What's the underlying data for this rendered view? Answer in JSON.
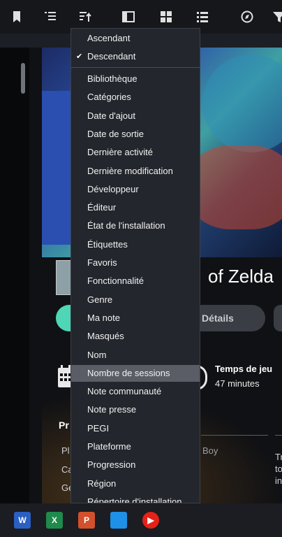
{
  "toolbar": {
    "icons": [
      "bookmark-icon",
      "list-indent-icon",
      "sort-icon",
      "panel-icon",
      "grid-view-icon",
      "list-view-icon",
      "explore-icon",
      "filter-icon"
    ]
  },
  "background": {
    "game_title_fragment": "of Zelda",
    "details_button": "Détails",
    "playtime_label": "Temps de jeu",
    "playtime_value": "47 minutes",
    "section_fragment": "Pr",
    "row_frag_1": "Pl",
    "row_frag_2": "Ca",
    "row_frag_3": "Ge",
    "platform_fragment": "Boy",
    "right_frag_1": "Tr",
    "right_frag_2": "to",
    "right_frag_3": "in"
  },
  "sort_menu": {
    "order_options": [
      {
        "label": "Ascendant",
        "checked": false
      },
      {
        "label": "Descendant",
        "checked": true
      }
    ],
    "check_mark": "✔",
    "sort_fields": [
      "Bibliothèque",
      "Catégories",
      "Date d'ajout",
      "Date de sortie",
      "Dernière activité",
      "Dernière modification",
      "Développeur",
      "Éditeur",
      "État de l'installation",
      "Étiquettes",
      "Favoris",
      "Fonctionnalité",
      "Genre",
      "Ma note",
      "Masqués",
      "Nom",
      "Nombre de sessions",
      "Note communauté",
      "Note presse",
      "PEGI",
      "Plateforme",
      "Progression",
      "Région",
      "Répertoire d'installation"
    ],
    "highlighted": "Nombre de sessions"
  },
  "taskbar": {
    "apps": [
      {
        "name": "word-icon",
        "glyph": "W",
        "color": "#2b5fc2"
      },
      {
        "name": "excel-icon",
        "glyph": "X",
        "color": "#1f8a4c"
      },
      {
        "name": "powerpoint-icon",
        "glyph": "P",
        "color": "#d2502b"
      },
      {
        "name": "phone-link-icon",
        "glyph": "",
        "color": "#1e90e8"
      },
      {
        "name": "youtube-music-icon",
        "glyph": "▶",
        "color": "#e62117"
      }
    ]
  }
}
